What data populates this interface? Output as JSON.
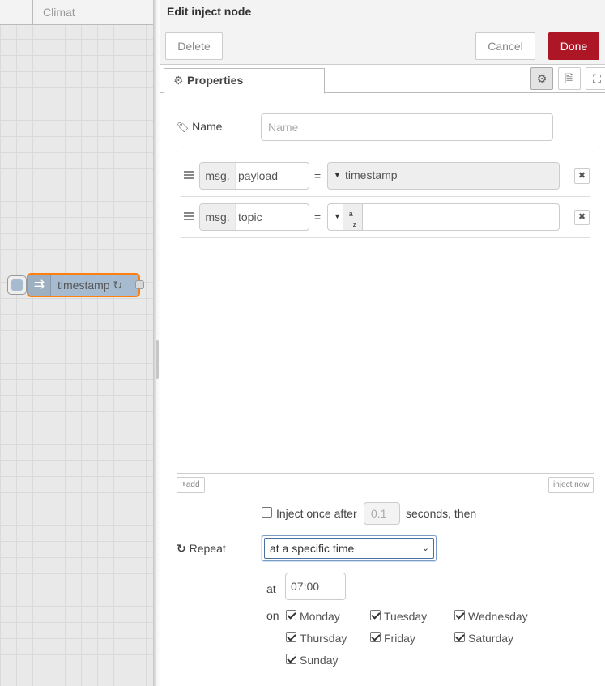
{
  "workspace": {
    "tabs": [
      "",
      "Climat"
    ],
    "node": {
      "label": "timestamp ↻"
    }
  },
  "tray": {
    "title": "Edit inject node",
    "buttons": {
      "delete": "Delete",
      "cancel": "Cancel",
      "done": "Done"
    },
    "tabs": {
      "properties": "Properties"
    }
  },
  "form": {
    "name": {
      "label": "Name",
      "placeholder": "Name",
      "value": ""
    },
    "props": [
      {
        "prefix": "msg.",
        "property": "payload",
        "type_label": "timestamp"
      },
      {
        "prefix": "msg.",
        "property": "topic",
        "type_icon": "string-az-icon",
        "value": ""
      }
    ],
    "equals": "=",
    "remove_glyph": "✖",
    "add_label": "add",
    "inject_now_label": "inject now",
    "inject_once": {
      "label": "Inject once after",
      "checked": false,
      "delay": "0.1",
      "suffix": "seconds, then"
    },
    "repeat": {
      "label": "Repeat",
      "selected": "at a specific time"
    },
    "at": {
      "label": "at",
      "time": "07:00"
    },
    "on": {
      "label": "on",
      "days": [
        {
          "name": "Monday",
          "checked": true
        },
        {
          "name": "Tuesday",
          "checked": true
        },
        {
          "name": "Wednesday",
          "checked": true
        },
        {
          "name": "Thursday",
          "checked": true
        },
        {
          "name": "Friday",
          "checked": true
        },
        {
          "name": "Saturday",
          "checked": true
        },
        {
          "name": "Sunday",
          "checked": true
        }
      ]
    }
  },
  "colors": {
    "done_button": "#ad1625",
    "node_fill": "#a6bbcf",
    "node_selected_border": "#ff7f0e"
  }
}
